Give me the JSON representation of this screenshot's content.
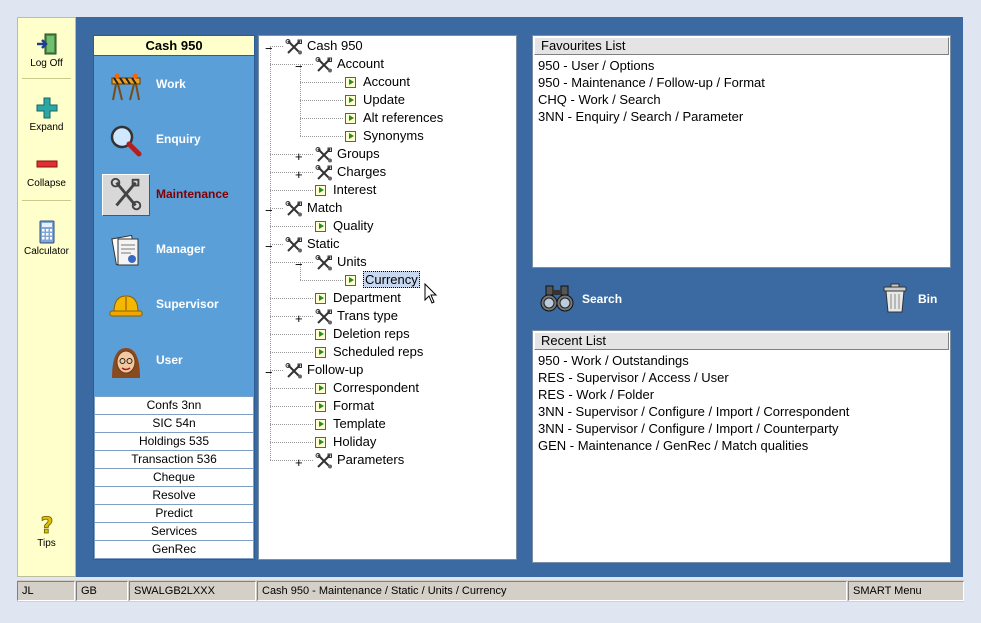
{
  "toolbar": {
    "log_off": "Log Off",
    "expand": "Expand",
    "collapse": "Collapse",
    "calculator": "Calculator",
    "tips": "Tips"
  },
  "launcher": {
    "title": "Cash 950",
    "menu": [
      {
        "label": "Work",
        "icon": "barrier-icon"
      },
      {
        "label": "Enquiry",
        "icon": "magnifier-icon"
      },
      {
        "label": "Maintenance",
        "icon": "tools-icon",
        "active": true
      },
      {
        "label": "Manager",
        "icon": "documents-icon"
      },
      {
        "label": "Supervisor",
        "icon": "hardhat-icon"
      },
      {
        "label": "User",
        "icon": "user-face-icon"
      }
    ],
    "sub_items": [
      "Confs 3nn",
      "SIC 54n",
      "Holdings 535",
      "Transaction 536",
      "Cheque",
      "Resolve",
      "Predict",
      "Services",
      "GenRec"
    ]
  },
  "tree": {
    "nodes": [
      {
        "label": "Cash 950",
        "level": 0,
        "kind": "folder",
        "expander": "-"
      },
      {
        "label": "Account",
        "level": 1,
        "kind": "folder",
        "expander": "-"
      },
      {
        "label": "Account",
        "level": 2,
        "kind": "leaf"
      },
      {
        "label": "Update",
        "level": 2,
        "kind": "leaf"
      },
      {
        "label": "Alt references",
        "level": 2,
        "kind": "leaf"
      },
      {
        "label": "Synonyms",
        "level": 2,
        "kind": "leaf"
      },
      {
        "label": "Groups",
        "level": 1,
        "kind": "folder",
        "expander": "+"
      },
      {
        "label": "Charges",
        "level": 1,
        "kind": "folder",
        "expander": "+"
      },
      {
        "label": "Interest",
        "level": 1,
        "kind": "leaf"
      },
      {
        "label": "Match",
        "level": 0,
        "kind": "folder",
        "expander": "-"
      },
      {
        "label": "Quality",
        "level": 1,
        "kind": "leaf"
      },
      {
        "label": "Static",
        "level": 0,
        "kind": "folder",
        "expander": "-"
      },
      {
        "label": "Units",
        "level": 1,
        "kind": "folder",
        "expander": "-"
      },
      {
        "label": "Currency",
        "level": 2,
        "kind": "leaf",
        "selected": true
      },
      {
        "label": "Department",
        "level": 1,
        "kind": "leaf"
      },
      {
        "label": "Trans type",
        "level": 1,
        "kind": "folder",
        "expander": "+"
      },
      {
        "label": "Deletion reps",
        "level": 1,
        "kind": "leaf"
      },
      {
        "label": "Scheduled reps",
        "level": 1,
        "kind": "leaf"
      },
      {
        "label": "Follow-up",
        "level": 0,
        "kind": "folder",
        "expander": "-"
      },
      {
        "label": "Correspondent",
        "level": 1,
        "kind": "leaf"
      },
      {
        "label": "Format",
        "level": 1,
        "kind": "leaf"
      },
      {
        "label": "Template",
        "level": 1,
        "kind": "leaf"
      },
      {
        "label": "Holiday",
        "level": 1,
        "kind": "leaf"
      },
      {
        "label": "Parameters",
        "level": 1,
        "kind": "folder",
        "expander": "+"
      }
    ]
  },
  "favourites": {
    "title": "Favourites List",
    "items": [
      "950 - User / Options",
      "950 - Maintenance / Follow-up / Format",
      "CHQ - Work / Search",
      "3NN - Enquiry / Search / Parameter"
    ]
  },
  "actions": {
    "search": "Search",
    "bin": "Bin"
  },
  "recent": {
    "title": "Recent List",
    "items": [
      "950 - Work / Outstandings",
      "RES - Supervisor / Access / User",
      "RES - Work / Folder",
      "3NN - Supervisor / Configure / Import / Correspondent",
      "3NN - Supervisor / Configure / Import / Counterparty",
      "GEN - Maintenance / GenRec / Match qualities"
    ]
  },
  "status": {
    "user": "JL",
    "country": "GB",
    "bic": "SWALGB2LXXX",
    "path": "Cash 950 - Maintenance / Static / Units / Currency",
    "menu": "SMART Menu"
  },
  "colors": {
    "main_bg": "#3a6aa1",
    "launcher_bg": "#5a9fd8",
    "toolbar_bg": "#ffffcc",
    "active_label": "#800000"
  }
}
